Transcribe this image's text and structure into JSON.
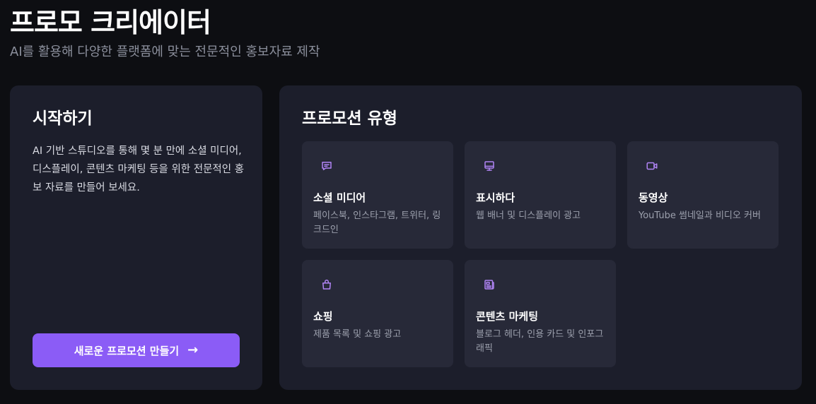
{
  "header": {
    "title": "프로모 크리에이터",
    "subtitle": "AI를 활용해 다양한 플랫폼에 맞는 전문적인 홍보자료 제작"
  },
  "start": {
    "heading": "시작하기",
    "description": "AI 기반 스튜디오를 통해 몇 분 만에 소셜 미디어, 디스플레이, 콘텐츠 마케팅 등을 위한 전문적인 홍보 자료를 만들어 보세요.",
    "button_label": "새로운 프로모션 만들기",
    "button_icon": "arrow-right-icon"
  },
  "types": {
    "heading": "프로모션 유형",
    "items": [
      {
        "icon": "message-icon",
        "title": "소셜 미디어",
        "description": "페이스북, 인스타그램, 트위터, 링크드인"
      },
      {
        "icon": "monitor-icon",
        "title": "표시하다",
        "description": "웹 배너 및 디스플레이 광고"
      },
      {
        "icon": "video-icon",
        "title": "동영상",
        "description": "YouTube 썸네일과 비디오 커버"
      },
      {
        "icon": "shopping-bag-icon",
        "title": "쇼핑",
        "description": "제품 목록 및 쇼핑 광고"
      },
      {
        "icon": "newspaper-icon",
        "title": "콘텐츠 마케팅",
        "description": "블로그 헤더, 인용 카드 및 인포그래픽"
      }
    ]
  },
  "colors": {
    "background": "#0d0e12",
    "panel": "#1c1e2b",
    "card": "#272938",
    "accent": "#8b5cf6",
    "icon": "#b084f5",
    "muted_text": "#9ca0ad"
  }
}
